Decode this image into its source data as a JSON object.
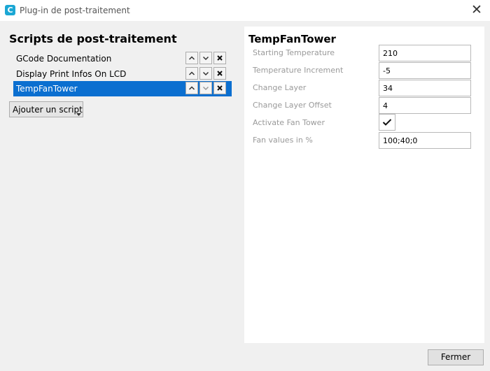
{
  "window": {
    "title": "Plug-in de post-traitement",
    "icon": "cura-icon",
    "icon_letter": "C",
    "accent_color": "#1ba7d4"
  },
  "left": {
    "title": "Scripts de post-traitement",
    "scripts": [
      {
        "label": "GCode Documentation",
        "selected": false
      },
      {
        "label": "Display Print Infos On LCD",
        "selected": false
      },
      {
        "label": "TempFanTower",
        "selected": true
      }
    ],
    "add_button_label": "Ajouter un script",
    "selection_color": "#0b6fd0"
  },
  "right": {
    "title": "TempFanTower",
    "settings": [
      {
        "label": "Starting Temperature",
        "value": "210"
      },
      {
        "label": "Temperature Increment",
        "value": "-5"
      },
      {
        "label": "Change Layer",
        "value": "34"
      },
      {
        "label": "Change Layer Offset",
        "value": "4"
      },
      {
        "label": "Activate Fan Tower",
        "checked": true
      },
      {
        "label": "Fan values in %",
        "value": "100;40;0"
      }
    ]
  },
  "footer": {
    "close_label": "Fermer"
  }
}
